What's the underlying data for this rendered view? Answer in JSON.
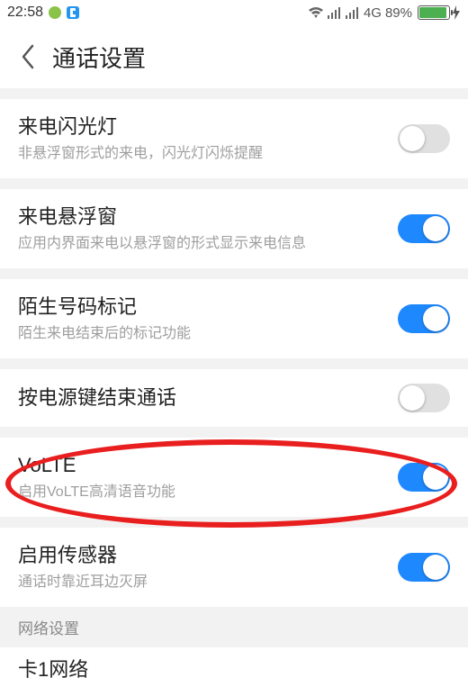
{
  "status": {
    "time": "22:58",
    "network_label": "4G",
    "battery_pct": "89%"
  },
  "header": {
    "title": "通话设置"
  },
  "items": {
    "flash": {
      "label": "来电闪光灯",
      "desc": "非悬浮窗形式的来电，闪光灯闪烁提醒"
    },
    "float": {
      "label": "来电悬浮窗",
      "desc": "应用内界面来电以悬浮窗的形式显示来电信息"
    },
    "stranger": {
      "label": "陌生号码标记",
      "desc": "陌生来电结束后的标记功能"
    },
    "powerend": {
      "label": "按电源键结束通话"
    },
    "volte": {
      "label": "VoLTE",
      "desc": "启用VoLTE高清语音功能"
    },
    "sensor": {
      "label": "启用传感器",
      "desc": "通话时靠近耳边灭屏"
    }
  },
  "section": {
    "network": "网络设置"
  },
  "partial": {
    "card1": "卡1网络"
  }
}
